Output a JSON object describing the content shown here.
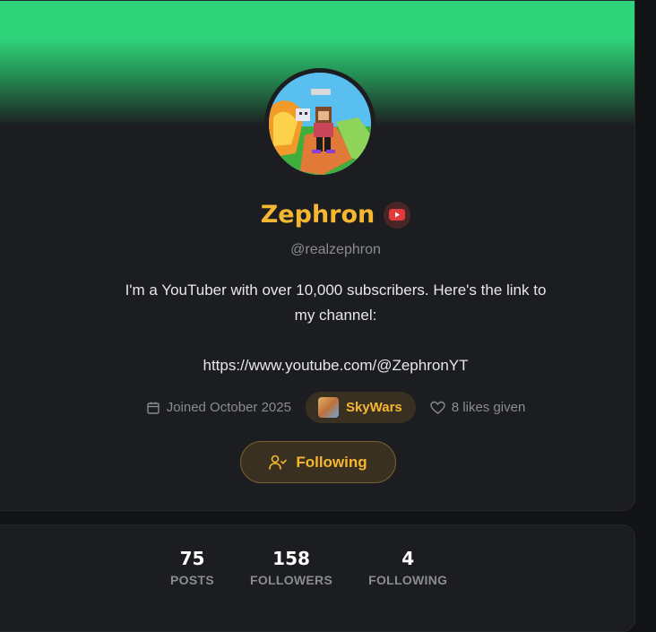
{
  "profile": {
    "display_name": "Zephron",
    "handle": "@realzephron",
    "bio_lines": [
      "I'm a YouTuber with over 10,000 subscribers. Here's the link to",
      "my channel:",
      "",
      "https://www.youtube.com/@ZephronYT"
    ],
    "joined": "Joined October 2025",
    "game_tag": "SkyWars",
    "likes_given": "8 likes given",
    "follow_button_label": "Following"
  },
  "stats": [
    {
      "value": "75",
      "label": "POSTS"
    },
    {
      "value": "158",
      "label": "FOLLOWERS"
    },
    {
      "value": "4",
      "label": "FOLLOWING"
    }
  ],
  "colors": {
    "accent": "#f5b731",
    "banner": "#2fd47a",
    "card": "#1c1d20",
    "youtube_red": "#e03b3b"
  },
  "icons": {
    "badge": "youtube-icon",
    "joined": "calendar-icon",
    "likes": "heart-icon",
    "follow": "user-check-icon"
  }
}
